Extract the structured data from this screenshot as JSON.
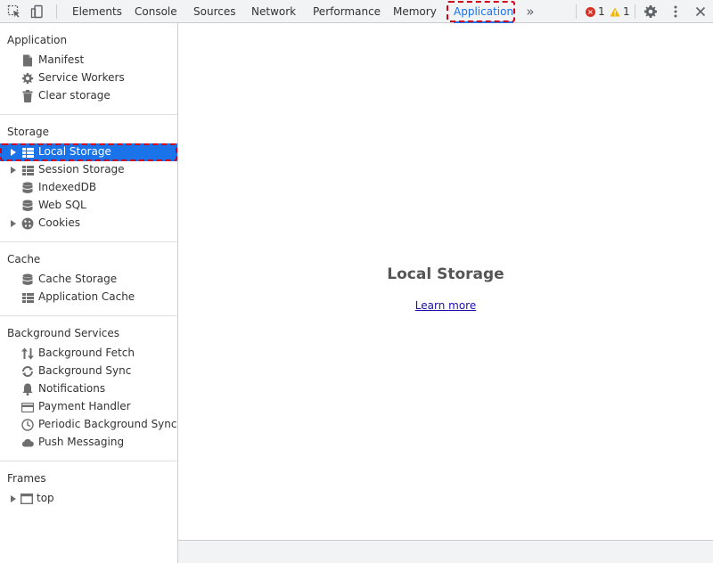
{
  "toolbar": {
    "tabs": [
      {
        "label": "Elements"
      },
      {
        "label": "Console"
      },
      {
        "label": "Sources"
      },
      {
        "label": "Network"
      },
      {
        "label": "Performance"
      },
      {
        "label": "Memory"
      },
      {
        "label": "Application"
      }
    ],
    "more_tabs_icon": "chevron-double-right-icon",
    "errors_count": "1",
    "warnings_count": "1"
  },
  "sidebar": {
    "sections": {
      "application": {
        "title": "Application",
        "items": [
          {
            "label": "Manifest",
            "icon": "document-icon"
          },
          {
            "label": "Service Workers",
            "icon": "gear-icon"
          },
          {
            "label": "Clear storage",
            "icon": "trash-icon"
          }
        ]
      },
      "storage": {
        "title": "Storage",
        "items": [
          {
            "label": "Local Storage",
            "icon": "grid-icon",
            "expandable": true,
            "selected": true
          },
          {
            "label": "Session Storage",
            "icon": "grid-icon",
            "expandable": true
          },
          {
            "label": "IndexedDB",
            "icon": "database-icon"
          },
          {
            "label": "Web SQL",
            "icon": "database-icon"
          },
          {
            "label": "Cookies",
            "icon": "cookie-icon",
            "expandable": true
          }
        ]
      },
      "cache": {
        "title": "Cache",
        "items": [
          {
            "label": "Cache Storage",
            "icon": "database-icon"
          },
          {
            "label": "Application Cache",
            "icon": "grid-icon"
          }
        ]
      },
      "background": {
        "title": "Background Services",
        "items": [
          {
            "label": "Background Fetch",
            "icon": "up-down-arrows-icon"
          },
          {
            "label": "Background Sync",
            "icon": "sync-icon"
          },
          {
            "label": "Notifications",
            "icon": "bell-icon"
          },
          {
            "label": "Payment Handler",
            "icon": "card-icon"
          },
          {
            "label": "Periodic Background Sync",
            "icon": "clock-icon"
          },
          {
            "label": "Push Messaging",
            "icon": "cloud-icon"
          }
        ]
      },
      "frames": {
        "title": "Frames",
        "items": [
          {
            "label": "top",
            "icon": "window-icon",
            "expandable": true
          }
        ]
      }
    }
  },
  "main": {
    "title": "Local Storage",
    "link_label": "Learn more"
  },
  "colors": {
    "accent": "#1a73e8",
    "annotation": "#d0021b",
    "error": "#d93025",
    "warning": "#f4b400"
  }
}
